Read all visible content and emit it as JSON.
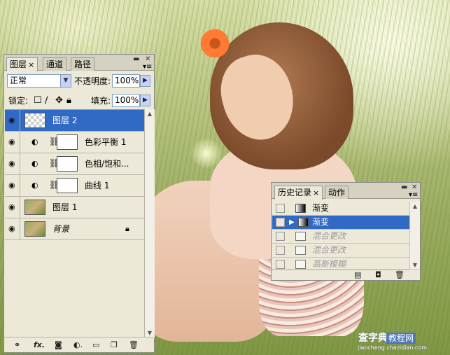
{
  "layers_panel": {
    "tabs": [
      {
        "label": "图层",
        "close": "×"
      },
      {
        "label": "通道"
      },
      {
        "label": "路径"
      }
    ],
    "window_controls": {
      "minimize": "▬",
      "close": "✕"
    },
    "blend_mode": "正常",
    "opacity_label": "不透明度:",
    "opacity_value": "100%",
    "lock_label": "锁定:",
    "fill_label": "填充:",
    "fill_value": "100%",
    "layers": [
      {
        "name": "图层 2",
        "selected": true
      },
      {
        "name": "色彩平衡 1"
      },
      {
        "name": "色相/饱和..."
      },
      {
        "name": "曲线 1"
      },
      {
        "name": "图层 1"
      },
      {
        "name": "背景"
      }
    ],
    "bottom_fx_label": "fx."
  },
  "history_panel": {
    "tabs": [
      {
        "label": "历史记录",
        "close": "×"
      },
      {
        "label": "动作"
      }
    ],
    "states": [
      {
        "label": "渐变"
      },
      {
        "label": "渐变",
        "selected": true
      },
      {
        "label": "混合更改",
        "disabled": true
      },
      {
        "label": "混合更改",
        "disabled": true
      },
      {
        "label": "高斯模糊",
        "disabled": true
      }
    ]
  },
  "watermark": {
    "site_cn_1": "查字典",
    "site_cn_2": "教程网",
    "url": "jiaocheng.chazidian.com"
  },
  "colors": {
    "selection": "#316ac5",
    "panel_bg": "#ece9d8"
  }
}
